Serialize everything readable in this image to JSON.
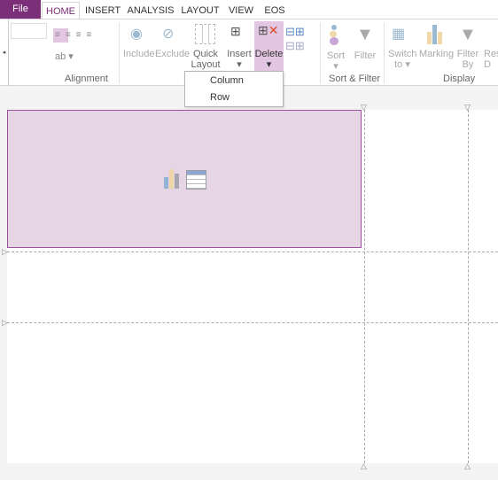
{
  "tabs": {
    "file": "File",
    "items": [
      "HOME",
      "INSERT",
      "ANALYSIS",
      "LAYOUT",
      "VIEW",
      "EOS"
    ],
    "active": "HOME"
  },
  "ribbon": {
    "include": "Include",
    "exclude": "Exclude",
    "quick_layout": [
      "Quick",
      "Layout"
    ],
    "insert": "Insert",
    "delete": "Delete",
    "sort": "Sort",
    "filter": "Filter",
    "switch_to": [
      "Switch",
      "to"
    ],
    "marking": "Marking",
    "filter_by": [
      "Filter",
      "By"
    ],
    "reset": [
      "Res",
      "D"
    ],
    "groups": {
      "alignment": "Alignment",
      "sort_filter": "Sort & Filter",
      "display": "Display"
    }
  },
  "delete_menu": {
    "items": [
      "Column",
      "Row"
    ]
  },
  "colors": {
    "accent": "#7b2f78",
    "selected_bg": "#e3c6e2",
    "viz_placeholder": "#e5d5e5"
  }
}
